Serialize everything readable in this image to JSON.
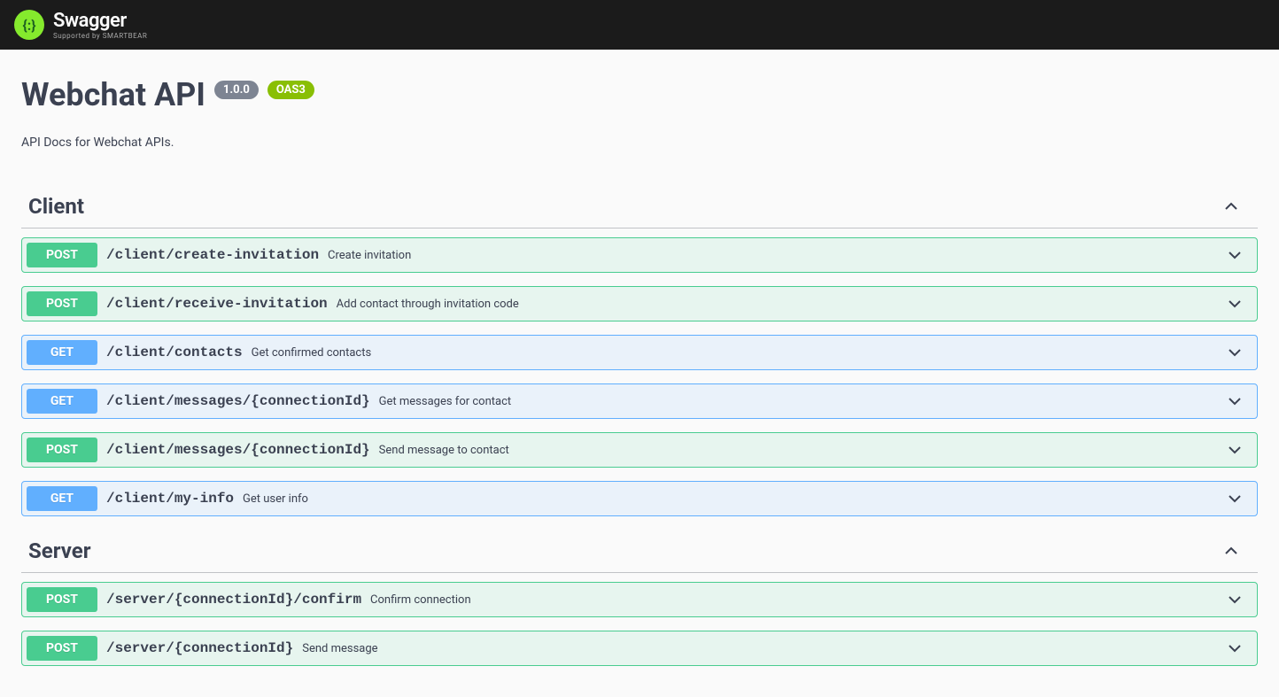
{
  "brand": {
    "name": "Swagger",
    "tagline": "Supported by SMARTBEAR",
    "logo_glyph": "{:}"
  },
  "api": {
    "title": "Webchat API",
    "version": "1.0.0",
    "oas_label": "OAS3",
    "description": "API Docs for Webchat APIs."
  },
  "tags": [
    {
      "name": "Client",
      "ops": [
        {
          "method": "POST",
          "path": "/client/create-invitation",
          "summary": "Create invitation"
        },
        {
          "method": "POST",
          "path": "/client/receive-invitation",
          "summary": "Add contact through invitation code"
        },
        {
          "method": "GET",
          "path": "/client/contacts",
          "summary": "Get confirmed contacts"
        },
        {
          "method": "GET",
          "path": "/client/messages/{connectionId}",
          "summary": "Get messages for contact"
        },
        {
          "method": "POST",
          "path": "/client/messages/{connectionId}",
          "summary": "Send message to contact"
        },
        {
          "method": "GET",
          "path": "/client/my-info",
          "summary": "Get user info"
        }
      ]
    },
    {
      "name": "Server",
      "ops": [
        {
          "method": "POST",
          "path": "/server/{connectionId}/confirm",
          "summary": "Confirm connection"
        },
        {
          "method": "POST",
          "path": "/server/{connectionId}",
          "summary": "Send message"
        }
      ]
    }
  ]
}
